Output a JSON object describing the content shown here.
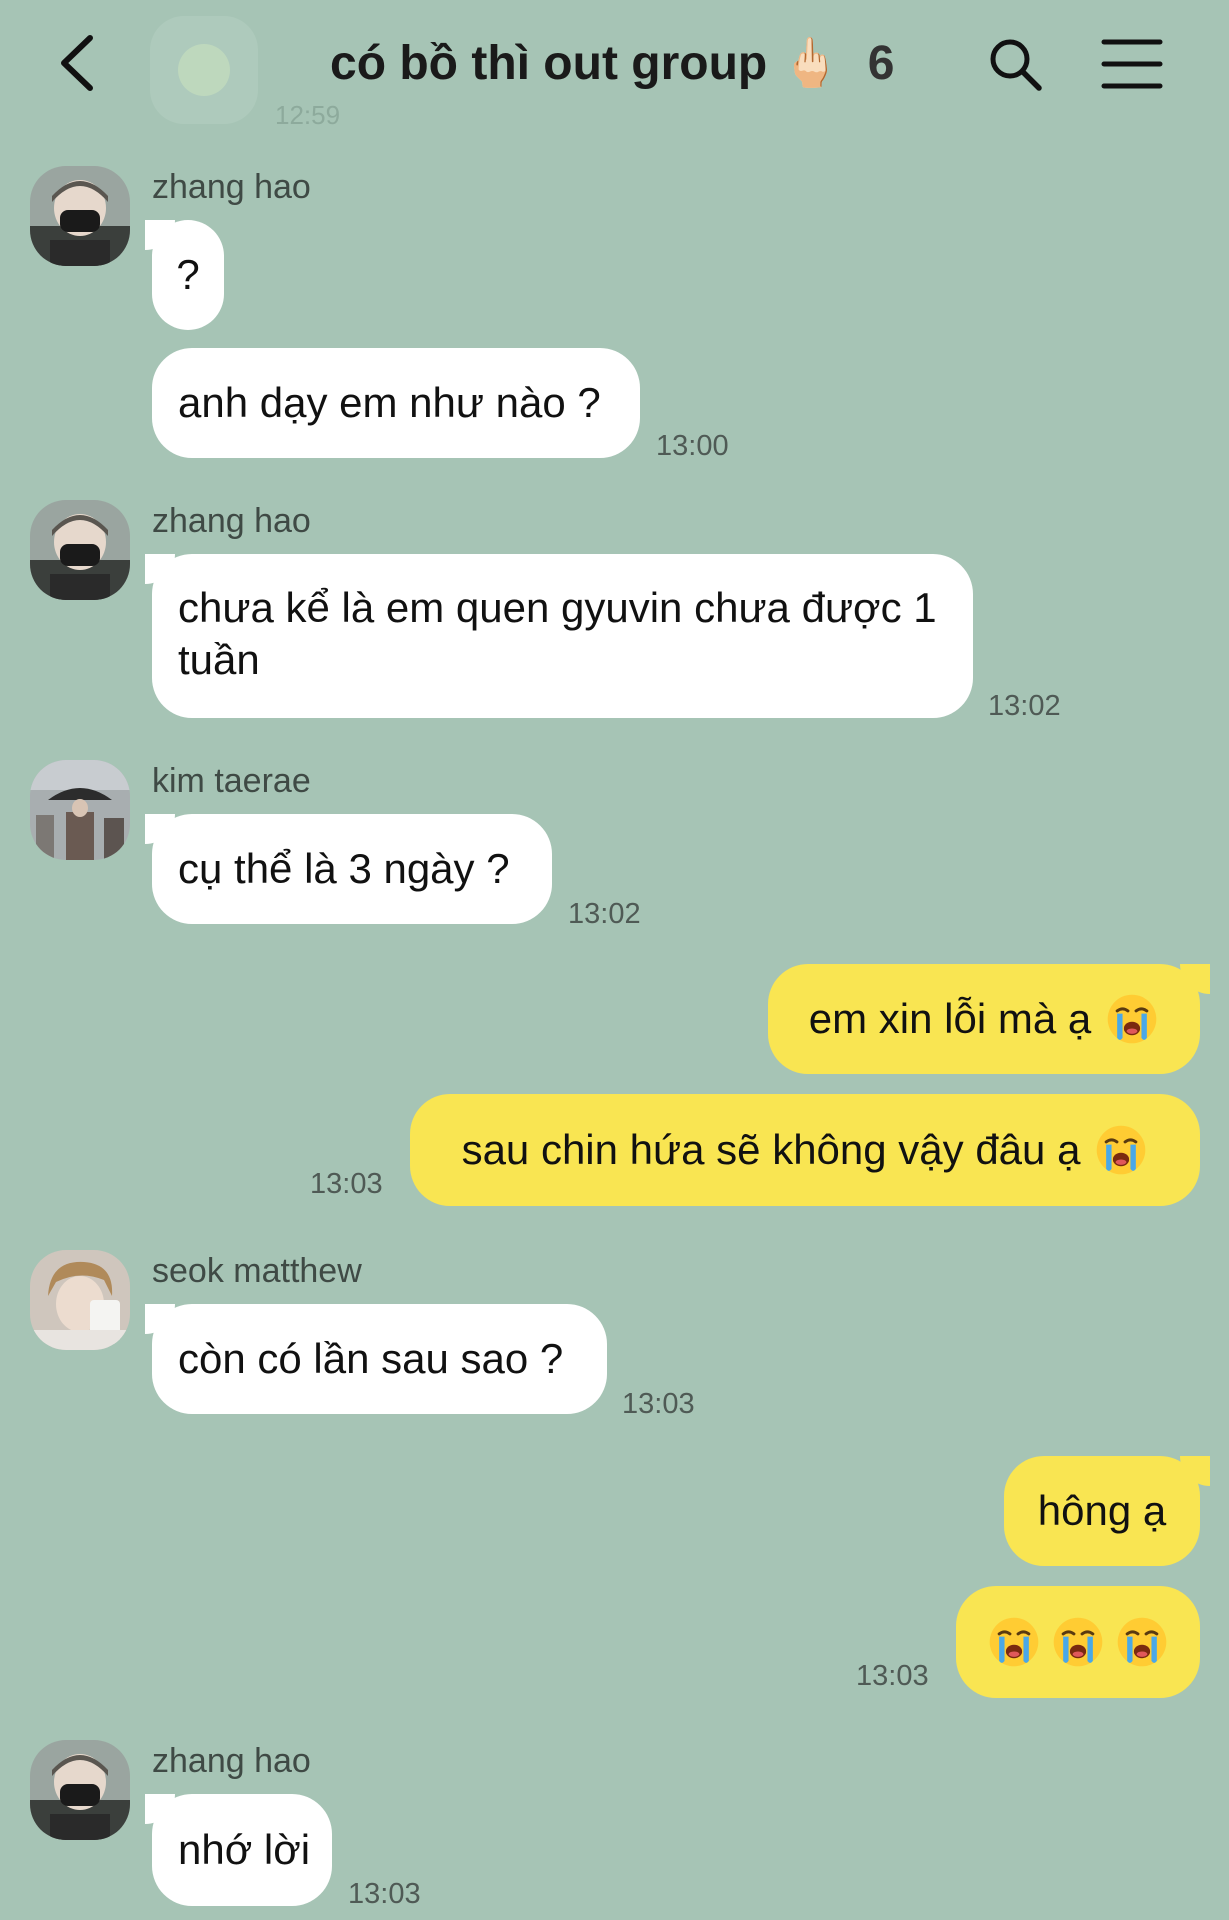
{
  "header": {
    "title": "có bồ thì out group",
    "title_emoji": "🖕🏻",
    "member_count": "6",
    "ghost_time": "12:59"
  },
  "messages": {
    "m1": {
      "sender": "zhang hao",
      "texts": [
        "?",
        "anh dạy em như nào ?"
      ],
      "time": "13:00"
    },
    "m2": {
      "sender": "zhang hao",
      "text": "chưa kể là em quen gyuvin chưa được 1 tuần",
      "time": "13:02"
    },
    "m3": {
      "sender": "kim taerae",
      "text": "cụ thể là 3 ngày ?",
      "time": "13:02"
    },
    "m4": {
      "texts": [
        "em xin lỗi mà ạ",
        "sau chin hứa sẽ không vậy đâu ạ"
      ],
      "time": "13:03"
    },
    "m5": {
      "sender": "seok matthew",
      "text": "còn có lần sau sao ?",
      "time": "13:03"
    },
    "m6": {
      "texts": [
        "hông ạ"
      ],
      "time": "13:03"
    },
    "m7": {
      "sender": "zhang hao",
      "text": "nhớ lời",
      "time": "13:03"
    }
  },
  "icons": {
    "back": "chevron-left-icon",
    "search": "search-icon",
    "menu": "menu-icon",
    "emoji": "loudly-crying-face-icon"
  },
  "colors": {
    "background": "#a6c4b5",
    "incoming_bubble": "#ffffff",
    "outgoing_bubble": "#f9e552"
  }
}
